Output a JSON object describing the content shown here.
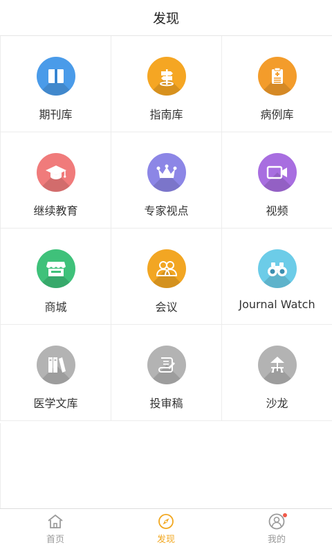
{
  "header": {
    "title": "发现"
  },
  "grid": {
    "items": [
      {
        "label": "期刊库",
        "icon": "book-icon",
        "color": "#4a9be9"
      },
      {
        "label": "指南库",
        "icon": "signpost-icon",
        "color": "#f5a623"
      },
      {
        "label": "病例库",
        "icon": "clipboard-icon",
        "color": "#f39c2b"
      },
      {
        "label": "继续教育",
        "icon": "graduation-cap-icon",
        "color": "#f07b7b"
      },
      {
        "label": "专家视点",
        "icon": "crown-icon",
        "color": "#8c86e6"
      },
      {
        "label": "视频",
        "icon": "video-camera-icon",
        "color": "#a86ee0"
      },
      {
        "label": "商城",
        "icon": "store-icon",
        "color": "#3fc17a"
      },
      {
        "label": "会议",
        "icon": "people-icon",
        "color": "#f2a623"
      },
      {
        "label": "Journal Watch",
        "icon": "binoculars-icon",
        "color": "#6ccce8"
      },
      {
        "label": "医学文库",
        "icon": "books-icon",
        "color": "#b3b3b3"
      },
      {
        "label": "投审稿",
        "icon": "manuscript-icon",
        "color": "#b3b3b3"
      },
      {
        "label": "沙龙",
        "icon": "parasol-icon",
        "color": "#b3b3b3"
      }
    ]
  },
  "tabbar": {
    "tabs": [
      {
        "label": "首页",
        "icon": "home-icon",
        "active": false
      },
      {
        "label": "发现",
        "icon": "compass-icon",
        "active": true
      },
      {
        "label": "我的",
        "icon": "user-icon",
        "active": false
      }
    ],
    "accent": "#f2a71f",
    "badge_color": "#f05a4a"
  }
}
